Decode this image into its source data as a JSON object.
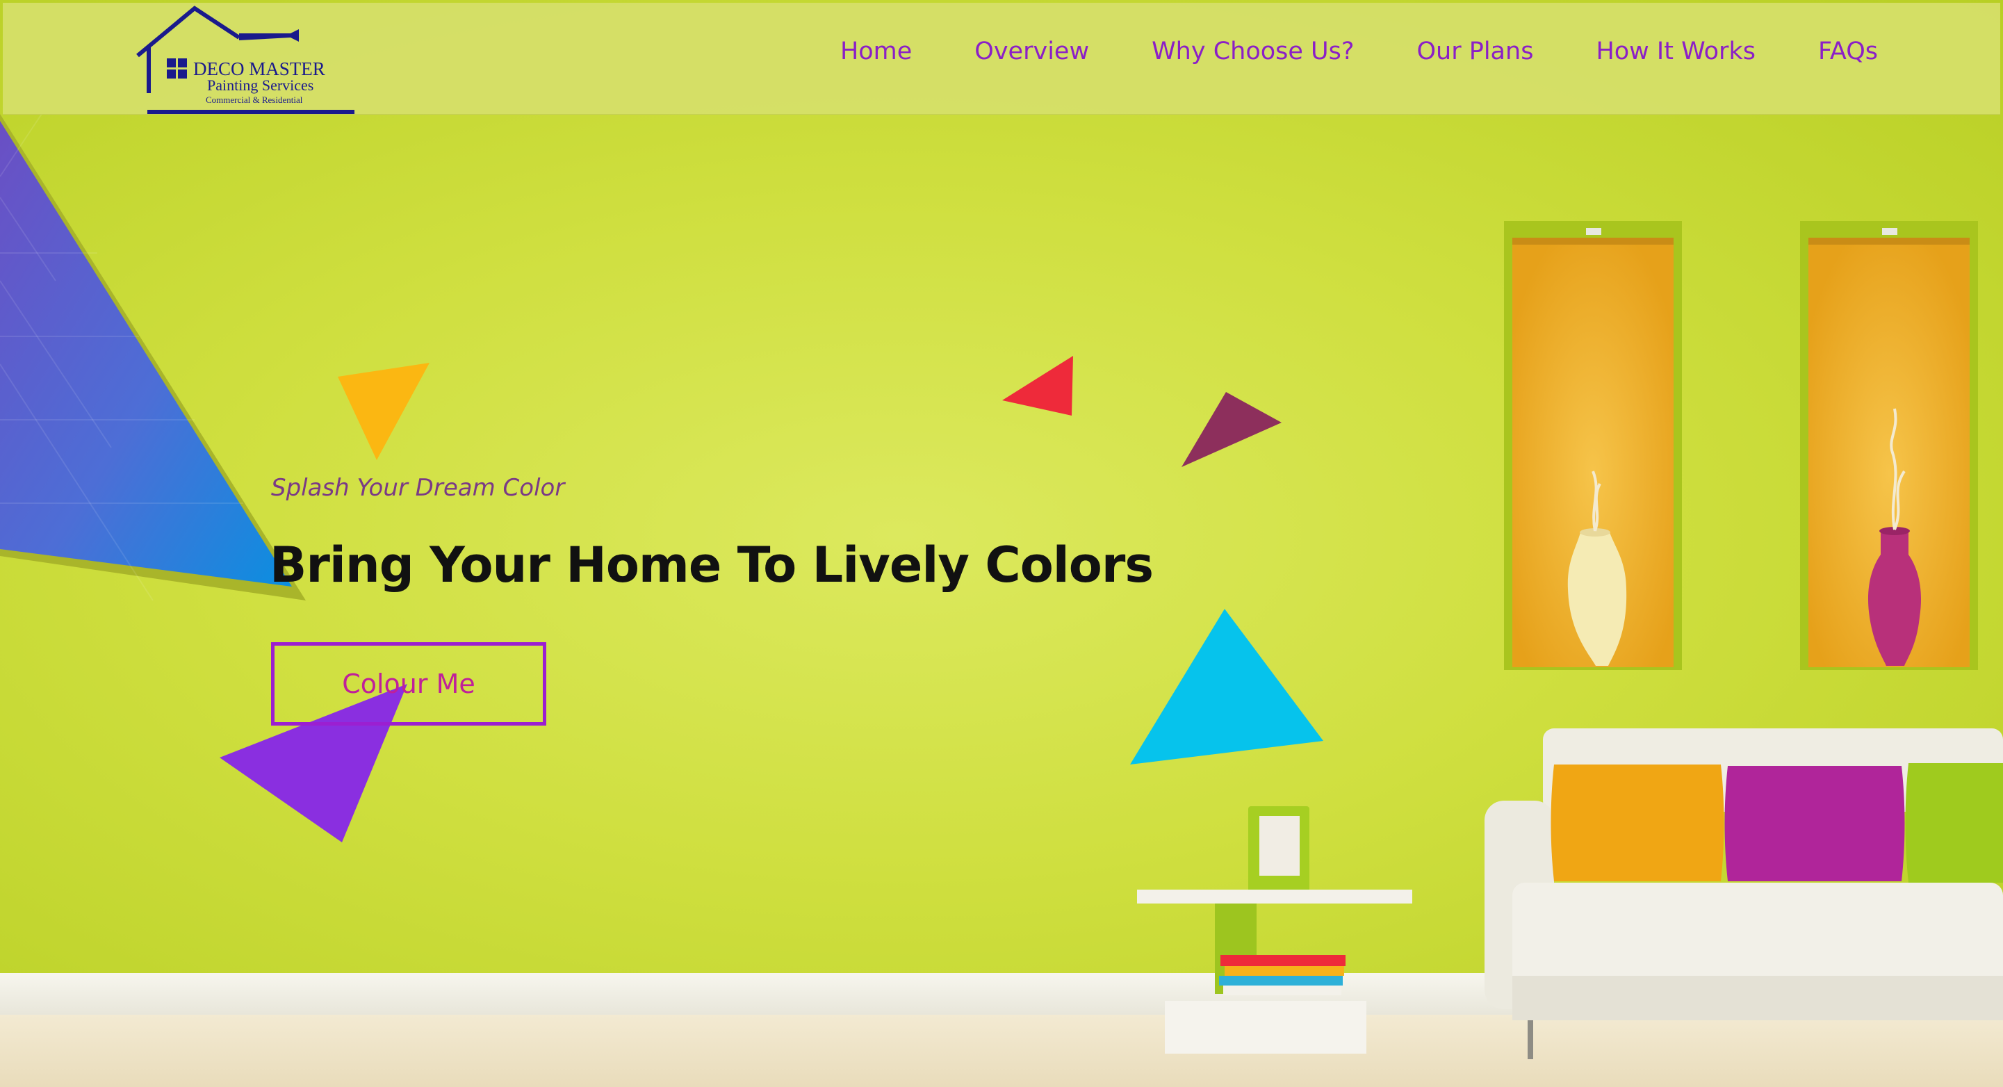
{
  "brand": {
    "name": "DECO MASTER",
    "line2": "Painting Services",
    "line3": "Commercial & Residential",
    "color": "#1a1a8c"
  },
  "nav": {
    "items": [
      "Home",
      "Overview",
      "Why Choose Us?",
      "Our Plans",
      "How It Works",
      "FAQs"
    ],
    "color": "#8b1fc7"
  },
  "hero": {
    "tagline": "Splash Your Dream Color",
    "headline": "Bring Your Home To Lively Colors",
    "cta_label": "Colour Me"
  },
  "theme": {
    "wall": "#cfdf3f",
    "header_bg": "#d6e06a",
    "accent_purple": "#9b1fd1",
    "cta_text": "#c0209a"
  }
}
